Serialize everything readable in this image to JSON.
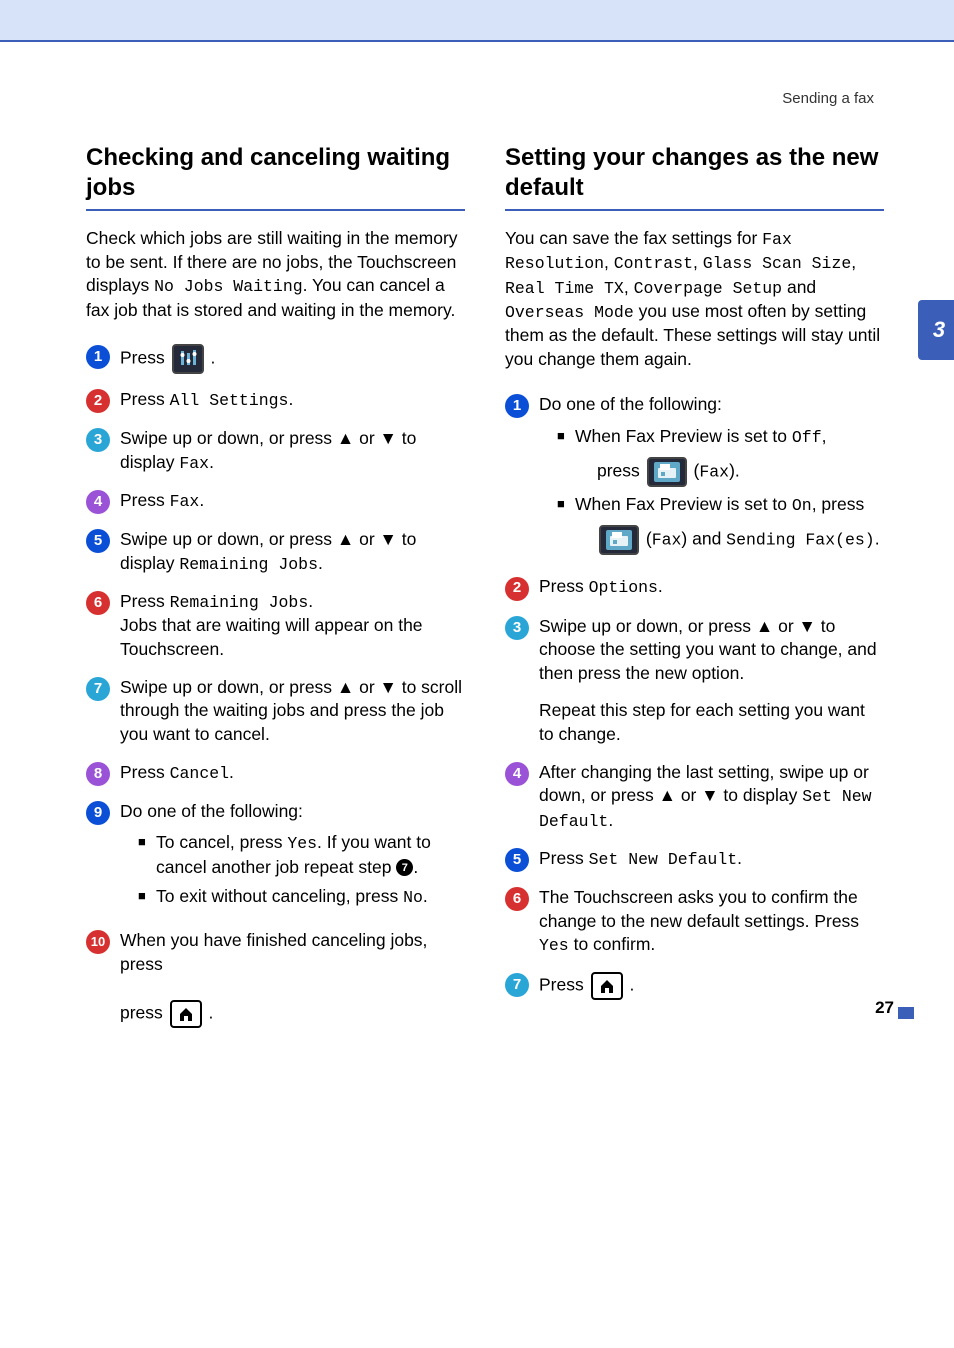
{
  "header": {
    "breadcrumb": "Sending a fax"
  },
  "tab": {
    "label": "3"
  },
  "pageNumber": "27",
  "left": {
    "title": "Checking and canceling waiting jobs",
    "intro": {
      "t1": "Check which jobs are still waiting in the memory to be sent. If there are no jobs, the Touchscreen displays ",
      "mono1": "No Jobs Waiting",
      "t2": ". You can cancel a fax job that is stored and waiting in the memory."
    },
    "steps": {
      "s1": {
        "a": "Press ",
        "b": "."
      },
      "s2": {
        "a": "Press ",
        "mono": "All Settings",
        "b": "."
      },
      "s3": {
        "a": "Swipe up or down, or press ▲ or ▼ to display ",
        "mono": "Fax",
        "b": "."
      },
      "s4": {
        "a": "Press ",
        "mono": "Fax",
        "b": "."
      },
      "s5": {
        "a": "Swipe up or down, or press ▲ or ▼ to display ",
        "mono": "Remaining Jobs",
        "b": "."
      },
      "s6": {
        "a": "Press ",
        "mono": "Remaining Jobs",
        "b": ".",
        "c": "Jobs that are waiting will appear on the Touchscreen."
      },
      "s7": {
        "a": "Swipe up or down, or press ▲ or ▼ to scroll through the waiting jobs and press the job you want to cancel."
      },
      "s8": {
        "a": "Press ",
        "mono": "Cancel",
        "b": "."
      },
      "s9": {
        "a": "Do one of the following:",
        "i1": {
          "a": "To cancel, press ",
          "mono": "Yes",
          "b": ". If you want to cancel another job repeat step ",
          "ref": "7",
          "c": "."
        },
        "i2": {
          "a": "To exit without canceling, press ",
          "mono": "No",
          "b": "."
        }
      },
      "s10": {
        "a": "When you have finished canceling jobs, press ",
        "b": "."
      }
    }
  },
  "right": {
    "title": "Setting your changes as the new default",
    "intro": {
      "t1": "You can save the fax settings for ",
      "m1": "Fax Resolution",
      "c1": ", ",
      "m2": "Contrast",
      "c2": ", ",
      "m3": "Glass Scan Size",
      "c3": ", ",
      "m4": "Real Time TX",
      "c4": ", ",
      "m5": "Coverpage Setup",
      "c5": " and ",
      "m6": "Overseas Mode",
      "t2": " you use most often by setting them as the default. These settings will stay until you change them again."
    },
    "steps": {
      "s1": {
        "a": "Do one of the following:",
        "i1": {
          "a": "When Fax Preview is set to ",
          "mono": "Off",
          "b": ",",
          "c": "press ",
          "d": " (",
          "m2": "Fax",
          "e": ")."
        },
        "i2": {
          "a": "When Fax Preview is set to ",
          "mono": "On",
          "b": ", press",
          "c": " (",
          "m2": "Fax",
          "d": ") and ",
          "m3": "Sending Fax(es)",
          "e": "."
        }
      },
      "s2": {
        "a": "Press ",
        "mono": "Options",
        "b": "."
      },
      "s3": {
        "a": "Swipe up or down, or press ▲ or ▼ to choose the setting you want to change, and then press the new option.",
        "b": "Repeat this step for each setting you want to change."
      },
      "s4": {
        "a": "After changing the last setting, swipe up or down, or press ▲ or ▼ to display ",
        "mono": "Set New Default",
        "b": "."
      },
      "s5": {
        "a": "Press ",
        "mono": "Set New Default",
        "b": "."
      },
      "s6": {
        "a": "The Touchscreen asks you to confirm the change to the new default settings. Press ",
        "mono": "Yes",
        "b": " to confirm."
      },
      "s7": {
        "a": "Press ",
        "b": "."
      }
    }
  }
}
